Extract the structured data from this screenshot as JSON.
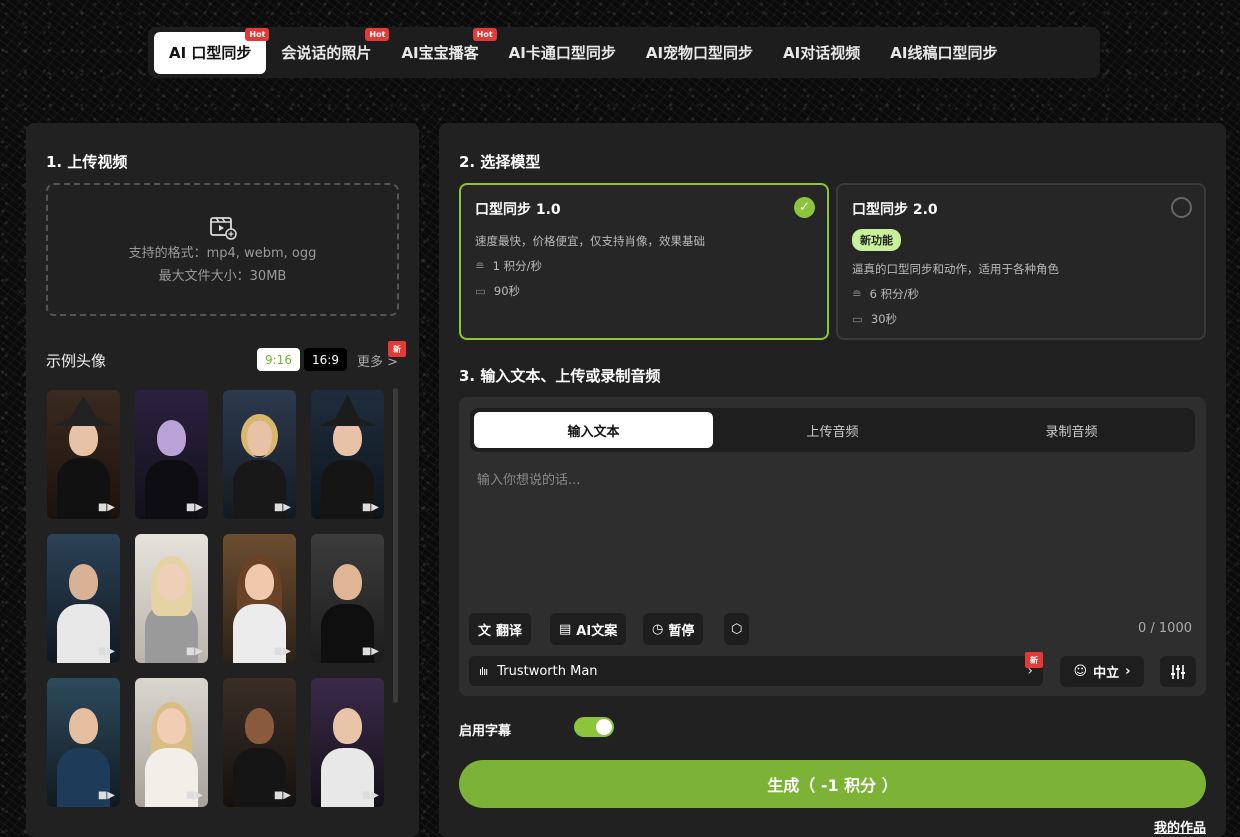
{
  "tabs": [
    {
      "label": "AI 口型同步",
      "hot": "Hot"
    },
    {
      "label": "会说话的照片",
      "hot": "Hot"
    },
    {
      "label": "AI宝宝播客",
      "hot": "Hot"
    },
    {
      "label": "AI卡通口型同步"
    },
    {
      "label": "AI宠物口型同步"
    },
    {
      "label": "AI对话视频"
    },
    {
      "label": "AI线稿口型同步"
    }
  ],
  "upload": {
    "title": "1. 上传视频",
    "formats": "支持的格式：mp4, webm, ogg",
    "max_size": "最大文件大小：30MB"
  },
  "examples": {
    "title": "示例头像",
    "ratio_a": "9:16",
    "ratio_b": "16:9",
    "more": "更多 >",
    "new_badge": "新"
  },
  "model": {
    "title": "2. 选择模型",
    "cards": [
      {
        "title": "口型同步 1.0",
        "desc": "速度最快，价格便宜，仅支持肖像，效果基础",
        "cost": "1 积分/秒",
        "duration": "90秒"
      },
      {
        "title": "口型同步 2.0",
        "tag": "新功能",
        "desc": "逼真的口型同步和动作，适用于各种角色",
        "cost": "6 积分/秒",
        "duration": "30秒"
      }
    ]
  },
  "input": {
    "title": "3. 输入文本、上传或录制音频",
    "tabs": [
      "输入文本",
      "上传音频",
      "录制音频"
    ],
    "placeholder": "输入你想说的话...",
    "translate": "翻译",
    "ai_copy": "AI文案",
    "pause": "暂停",
    "counter": "0 / 1000",
    "voice": "Trustworth Man",
    "new_badge": "新",
    "mood": "中立"
  },
  "subtitle": {
    "label": "启用字幕"
  },
  "generate": {
    "label": "生成（ -1 积分 ）"
  },
  "my_works": "我的作品",
  "colors": {
    "accent": "#7cb236",
    "selected_border": "#8cc43c",
    "hot": "#e53935"
  }
}
